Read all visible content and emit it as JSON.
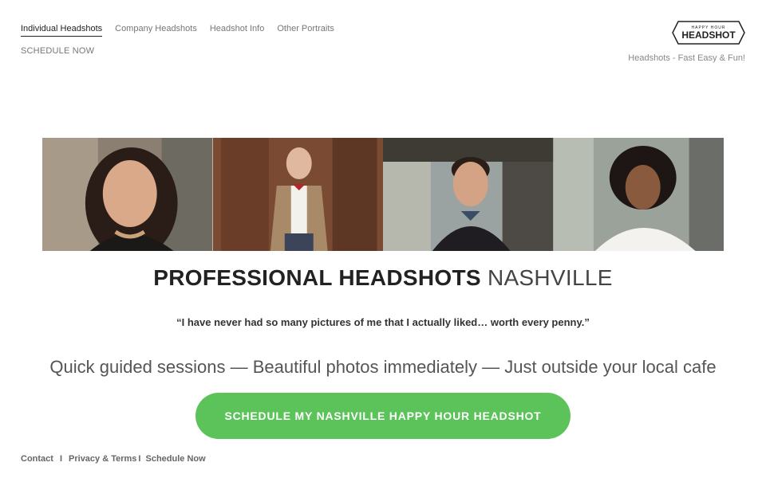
{
  "nav": {
    "items": [
      {
        "label": "Individual Headshots",
        "active": true
      },
      {
        "label": "Company Headshots",
        "active": false
      },
      {
        "label": "Headshot Info",
        "active": false
      },
      {
        "label": "Other Portraits",
        "active": false
      }
    ],
    "schedule_label": "SCHEDULE NOW"
  },
  "logo": {
    "top_text": "HAPPY HOUR",
    "main_text": "HEADSHOT"
  },
  "tagline": "Headshots - Fast Easy & Fun!",
  "hero": {
    "headline_bold": "PROFESSIONAL HEADSHOTS",
    "headline_light": "NASHVILLE",
    "quote": "“I have never had so many pictures of me that I actually liked… worth every penny.”",
    "subtitle": "Quick guided sessions — Beautiful photos immediately — Just outside your local cafe",
    "cta_label": "SCHEDULE MY NASHVILLE HAPPY HOUR HEADSHOT"
  },
  "footer": {
    "contact": "Contact",
    "sep1": "I",
    "privacy": "Privacy & Terms",
    "sep2": "I",
    "schedule": "Schedule Now"
  },
  "colors": {
    "cta": "#5cc35a",
    "text": "#333333"
  }
}
